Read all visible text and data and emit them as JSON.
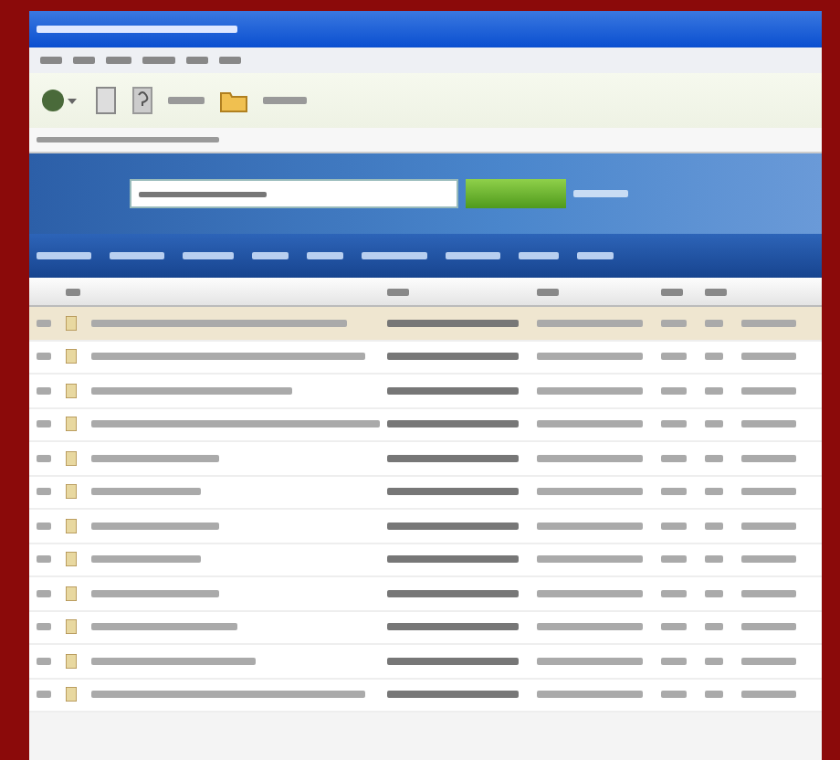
{
  "toolbar": {
    "buttons": [
      {
        "kind": "back"
      },
      {
        "kind": "page"
      },
      {
        "kind": "help"
      },
      {
        "kind": "folder"
      }
    ]
  },
  "table": {
    "rows": [
      {
        "selected": true
      },
      {
        "selected": false
      },
      {
        "selected": false
      },
      {
        "selected": false
      },
      {
        "selected": false
      },
      {
        "selected": false
      },
      {
        "selected": false
      },
      {
        "selected": false
      },
      {
        "selected": false
      },
      {
        "selected": false
      },
      {
        "selected": false
      },
      {
        "selected": false
      }
    ]
  }
}
